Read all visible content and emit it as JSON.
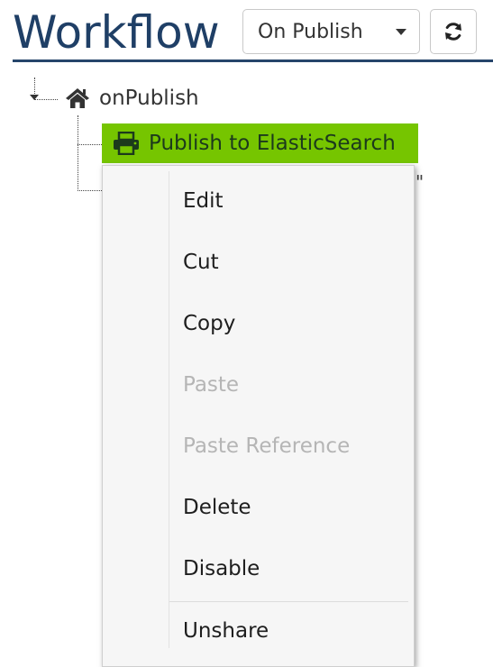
{
  "header": {
    "title": "Workflow",
    "dropdown_value": "On Publish",
    "dropdown_icon": "chevron-down-icon",
    "refresh_icon": "refresh-icon"
  },
  "tree": {
    "root": {
      "label": "onPublish",
      "icon": "home-icon"
    },
    "selected_node": {
      "label": "Publish to ElasticSearch",
      "icon": "printer-icon",
      "highlight_color": "#76c500"
    },
    "partially_hidden_text": "\""
  },
  "context_menu": {
    "items": [
      {
        "label": "Edit",
        "enabled": true
      },
      {
        "label": "Cut",
        "enabled": true
      },
      {
        "label": "Copy",
        "enabled": true
      },
      {
        "label": "Paste",
        "enabled": false
      },
      {
        "label": "Paste Reference",
        "enabled": false
      },
      {
        "label": "Delete",
        "enabled": true
      },
      {
        "label": "Disable",
        "enabled": true
      },
      {
        "label": "Unshare",
        "enabled": true
      }
    ]
  },
  "colors": {
    "title": "#1f3f66",
    "selection": "#76c500",
    "disabled_text": "#b5b5b5"
  }
}
